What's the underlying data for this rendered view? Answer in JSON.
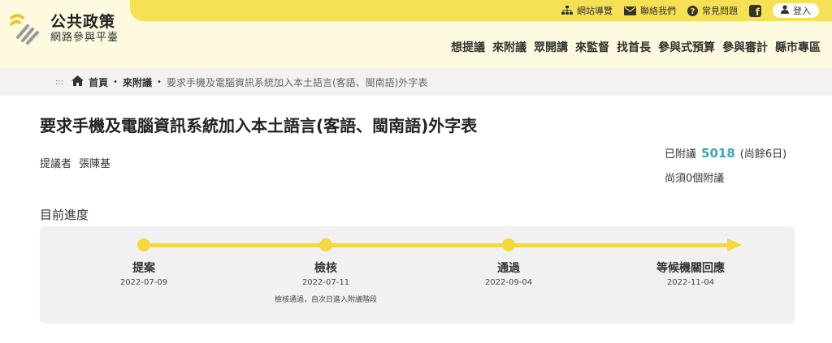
{
  "topbar": {
    "sitemap_label": "網站導覽",
    "contact_label": "聯絡我們",
    "faq_label": "常見問題",
    "facebook_glyph": "f",
    "login_label": "登入"
  },
  "logo": {
    "line1": "公共政策",
    "line2": "網路參與平臺"
  },
  "nav": {
    "items": [
      "想提議",
      "來附議",
      "眾開講",
      "來監督",
      "找首長",
      "參與式預算",
      "參與審計",
      "縣市專區"
    ]
  },
  "breadcrumb": {
    "marker": ":::",
    "home": "首頁",
    "sep": "•",
    "parent": "來附議",
    "current": "要求手機及電腦資訊系統加入本土語言(客語、閩南語)外字表"
  },
  "proposal": {
    "title": "要求手機及電腦資訊系統加入本土語言(客語、閩南語)外字表",
    "proposer_label": "提議者",
    "proposer_name": "張陳基",
    "signed_label": "已附議",
    "signed_count": "5018",
    "remaining": "(尚餘6日)",
    "needed": "尚須0個附議"
  },
  "progress": {
    "heading": "目前進度",
    "stages": [
      {
        "name": "提案",
        "date": "2022-07-09",
        "note": ""
      },
      {
        "name": "檢核",
        "date": "2022-07-11",
        "note": "檢核通過，自次日進入附議階段"
      },
      {
        "name": "通過",
        "date": "2022-09-04",
        "note": ""
      },
      {
        "name": "等候機關回應",
        "date": "2022-11-04",
        "note": ""
      }
    ]
  },
  "colors": {
    "accent_yellow": "#f3d83e",
    "header_bg": "#fdfae0",
    "count_teal": "#3aa7b8"
  }
}
